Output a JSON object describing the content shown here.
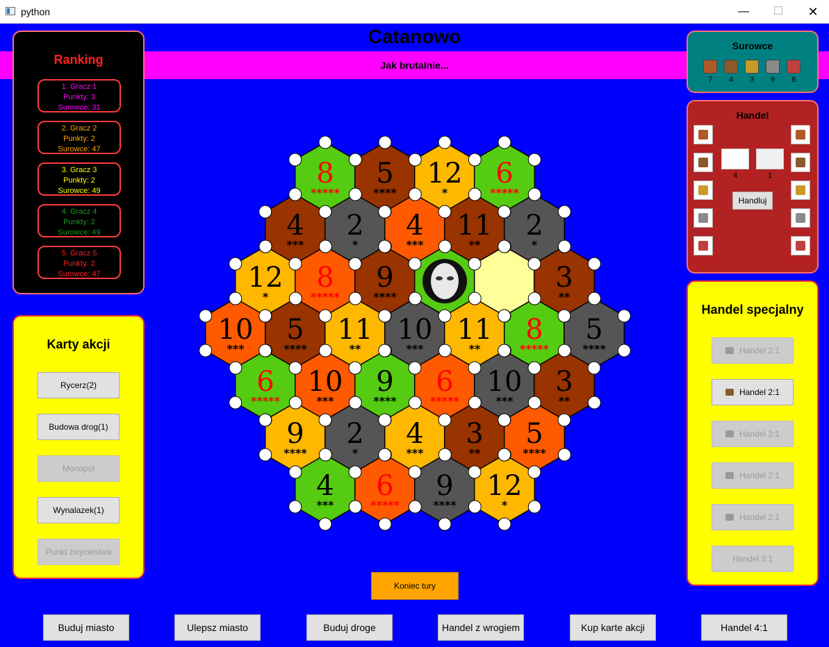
{
  "window": {
    "title": "python",
    "min": "—",
    "max": "☐",
    "close": "✕"
  },
  "game_title": "Catanowo",
  "banner_text": "Jak brutalnie...",
  "ranking": {
    "title": "Ranking",
    "players": [
      {
        "line1": "1. Gracz 1",
        "line2": "Punkty: 3",
        "line3": "Surowce: 31",
        "color": "#ff00ff"
      },
      {
        "line1": "2. Gracz 2",
        "line2": "Punkty: 2",
        "line3": "Surowce: 47",
        "color": "#ffa500"
      },
      {
        "line1": "3. Gracz 3",
        "line2": "Punkty: 2",
        "line3": "Surowce: 49",
        "color": "#ffff00"
      },
      {
        "line1": "4. Gracz 4",
        "line2": "Punkty: 2",
        "line3": "Surowce: 49",
        "color": "#1a9a1a"
      },
      {
        "line1": "5. Gracz 5",
        "line2": "Punkty: 2",
        "line3": "Surowce: 47",
        "color": "#ff2020"
      }
    ]
  },
  "karty": {
    "title": "Karty akcji",
    "buttons": [
      {
        "label": "Rycerz(2)",
        "enabled": true
      },
      {
        "label": "Budowa drog(1)",
        "enabled": true
      },
      {
        "label": "Monopol",
        "enabled": false
      },
      {
        "label": "Wynalazek(1)",
        "enabled": true
      },
      {
        "label": "Punkt zwyciestwa",
        "enabled": false
      }
    ]
  },
  "surowce": {
    "title": "Surowce",
    "items": [
      {
        "icon": "sheep-icon",
        "count": "7",
        "color": "#b05a2a"
      },
      {
        "icon": "wood-icon",
        "count": "4",
        "color": "#8a5a2a"
      },
      {
        "icon": "wheat-icon",
        "count": "3",
        "color": "#c89a2a"
      },
      {
        "icon": "ore-icon",
        "count": "9",
        "color": "#8a8a8a"
      },
      {
        "icon": "brick-icon",
        "count": "8",
        "color": "#c04040"
      }
    ]
  },
  "handel": {
    "title": "Handel",
    "give_value": "4",
    "get_value": "1",
    "button": "Handluj",
    "icons": [
      "sheep-icon",
      "wood-icon",
      "wheat-icon",
      "ore-icon",
      "brick-icon"
    ],
    "icon_colors": [
      "#b05a2a",
      "#8a5a2a",
      "#c89a2a",
      "#8a8a8a",
      "#c04040"
    ]
  },
  "specjalny": {
    "title": "Handel specjalny",
    "buttons": [
      {
        "label": "Handel 2:1",
        "icon": "sheep-icon",
        "enabled": false,
        "color": "#9a9a9a"
      },
      {
        "label": "Handel 2:1",
        "icon": "wood-icon",
        "enabled": true,
        "color": "#8a5a2a"
      },
      {
        "label": "Handel 2:1",
        "icon": "wheat-icon",
        "enabled": false,
        "color": "#9a9a9a"
      },
      {
        "label": "Handel 2:1",
        "icon": "ore-icon",
        "enabled": false,
        "color": "#9a9a9a"
      },
      {
        "label": "Handel 2:1",
        "icon": "brick-icon",
        "enabled": false,
        "color": "#9a9a9a"
      },
      {
        "label": "Handel 3:1",
        "icon": "",
        "enabled": false,
        "color": ""
      }
    ]
  },
  "koniec_button": "Koniec tury",
  "bottom_buttons": [
    "Buduj miasto",
    "Ulepsz miasto",
    "Buduj droge",
    "Handel z wrogiem",
    "Kup karte akcji",
    "Handel 4:1"
  ],
  "colors": {
    "orange": "#ff5a00",
    "brown": "#993300",
    "gold": "#ffb800",
    "green": "#55cc11",
    "gray": "#555555",
    "desert": "#ffff99"
  },
  "tiles": [
    {
      "row": 0,
      "col": 0,
      "type": "green",
      "number": "8",
      "dots": "*****",
      "red": true
    },
    {
      "row": 0,
      "col": 1,
      "type": "brown",
      "number": "5",
      "dots": "****",
      "red": false
    },
    {
      "row": 0,
      "col": 2,
      "type": "gold",
      "number": "12",
      "dots": "*",
      "red": false
    },
    {
      "row": 0,
      "col": 3,
      "type": "green",
      "number": "6",
      "dots": "*****",
      "red": true
    },
    {
      "row": 1,
      "col": 0,
      "type": "brown",
      "number": "4",
      "dots": "***",
      "red": false
    },
    {
      "row": 1,
      "col": 1,
      "type": "gray",
      "number": "2",
      "dots": "*",
      "red": false
    },
    {
      "row": 1,
      "col": 2,
      "type": "orange",
      "number": "4",
      "dots": "***",
      "red": false
    },
    {
      "row": 1,
      "col": 3,
      "type": "brown",
      "number": "11",
      "dots": "**",
      "red": false
    },
    {
      "row": 1,
      "col": 4,
      "type": "gray",
      "number": "2",
      "dots": "*",
      "red": false
    },
    {
      "row": 2,
      "col": 0,
      "type": "gold",
      "number": "12",
      "dots": "*",
      "red": false
    },
    {
      "row": 2,
      "col": 1,
      "type": "orange",
      "number": "8",
      "dots": "*****",
      "red": true
    },
    {
      "row": 2,
      "col": 2,
      "type": "brown",
      "number": "9",
      "dots": "****",
      "red": false
    },
    {
      "row": 2,
      "col": 3,
      "type": "green",
      "number": "",
      "dots": "",
      "red": false,
      "robber": true
    },
    {
      "row": 2,
      "col": 4,
      "type": "desert",
      "number": "",
      "dots": "",
      "red": false
    },
    {
      "row": 2,
      "col": 5,
      "type": "brown",
      "number": "3",
      "dots": "**",
      "red": false
    },
    {
      "row": 3,
      "col": 0,
      "type": "orange",
      "number": "10",
      "dots": "***",
      "red": false
    },
    {
      "row": 3,
      "col": 1,
      "type": "brown",
      "number": "5",
      "dots": "****",
      "red": false
    },
    {
      "row": 3,
      "col": 2,
      "type": "gold",
      "number": "11",
      "dots": "**",
      "red": false
    },
    {
      "row": 3,
      "col": 3,
      "type": "gray",
      "number": "10",
      "dots": "***",
      "red": false
    },
    {
      "row": 3,
      "col": 4,
      "type": "gold",
      "number": "11",
      "dots": "**",
      "red": false
    },
    {
      "row": 3,
      "col": 5,
      "type": "green",
      "number": "8",
      "dots": "*****",
      "red": true
    },
    {
      "row": 3,
      "col": 6,
      "type": "gray",
      "number": "5",
      "dots": "****",
      "red": false
    },
    {
      "row": 4,
      "col": 0,
      "type": "green",
      "number": "6",
      "dots": "*****",
      "red": true
    },
    {
      "row": 4,
      "col": 1,
      "type": "orange",
      "number": "10",
      "dots": "***",
      "red": false
    },
    {
      "row": 4,
      "col": 2,
      "type": "green",
      "number": "9",
      "dots": "****",
      "red": false
    },
    {
      "row": 4,
      "col": 3,
      "type": "orange",
      "number": "6",
      "dots": "*****",
      "red": true
    },
    {
      "row": 4,
      "col": 4,
      "type": "gray",
      "number": "10",
      "dots": "***",
      "red": false
    },
    {
      "row": 4,
      "col": 5,
      "type": "brown",
      "number": "3",
      "dots": "**",
      "red": false
    },
    {
      "row": 5,
      "col": 0,
      "type": "gold",
      "number": "9",
      "dots": "****",
      "red": false
    },
    {
      "row": 5,
      "col": 1,
      "type": "gray",
      "number": "2",
      "dots": "*",
      "red": false
    },
    {
      "row": 5,
      "col": 2,
      "type": "gold",
      "number": "4",
      "dots": "***",
      "red": false
    },
    {
      "row": 5,
      "col": 3,
      "type": "brown",
      "number": "3",
      "dots": "**",
      "red": false
    },
    {
      "row": 5,
      "col": 4,
      "type": "orange",
      "number": "5",
      "dots": "****",
      "red": false
    },
    {
      "row": 6,
      "col": 0,
      "type": "green",
      "number": "4",
      "dots": "***",
      "red": false
    },
    {
      "row": 6,
      "col": 1,
      "type": "orange",
      "number": "6",
      "dots": "*****",
      "red": true
    },
    {
      "row": 6,
      "col": 2,
      "type": "gray",
      "number": "9",
      "dots": "****",
      "red": false
    },
    {
      "row": 6,
      "col": 3,
      "type": "gold",
      "number": "12",
      "dots": "*",
      "red": false
    }
  ]
}
